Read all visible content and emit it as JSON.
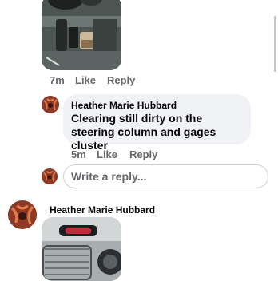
{
  "comment1": {
    "time": "7m",
    "like_label": "Like",
    "reply_label": "Reply"
  },
  "comment2": {
    "author": "Heather Marie Hubbard",
    "text": "Clearing still dirty on the steering column and gages cluster",
    "time": "5m",
    "like_label": "Like",
    "reply_label": "Reply"
  },
  "reply_box": {
    "placeholder": "Write a reply..."
  },
  "comment3": {
    "author": "Heather Marie Hubbard"
  }
}
